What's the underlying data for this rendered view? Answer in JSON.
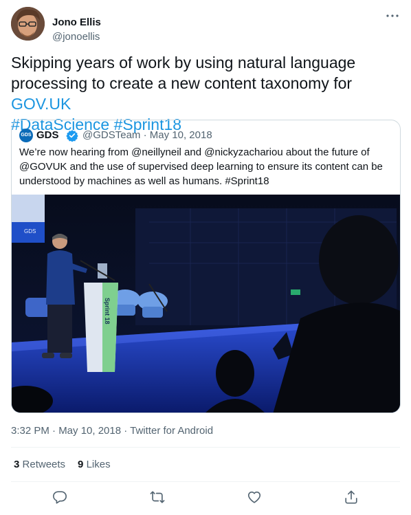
{
  "author": {
    "name": "Jono Ellis",
    "handle": "@jonoellis"
  },
  "tweet": {
    "text_plain": "Skipping years of work by using natural language processing to create a new content taxonomy for ",
    "link_govuk": "GOV.UK",
    "hashtag_1": "#DataScience",
    "hashtag_2": "#Sprint18"
  },
  "quoted": {
    "logo_text": "GDS",
    "name": "GDS",
    "handle": "@GDSTeam",
    "separator": "·",
    "date": "May 10, 2018",
    "text": "We’re now hearing from @neillyneil and @nickyzachariou about the future of @GOVUK and the use of supervised deep learning to ensure its content can be understood by machines as well as humans. #Sprint18",
    "photo": {
      "screen_label": "GDS",
      "lectern_text": "Sprint 18"
    }
  },
  "meta": {
    "timestamp": "3:32 PM · May 10, 2018 · Twitter for Android"
  },
  "stats": {
    "retweets_count": "3",
    "retweets_label": "Retweets",
    "likes_count": "9",
    "likes_label": "Likes"
  },
  "colors": {
    "link": "#1b95e0",
    "verified": "#1d9bf0",
    "muted_text": "#536471",
    "stage_blue": "#1d3fb3"
  },
  "icons": [
    "more-icon",
    "verified-icon",
    "reply-icon",
    "retweet-icon",
    "like-icon",
    "share-icon"
  ]
}
